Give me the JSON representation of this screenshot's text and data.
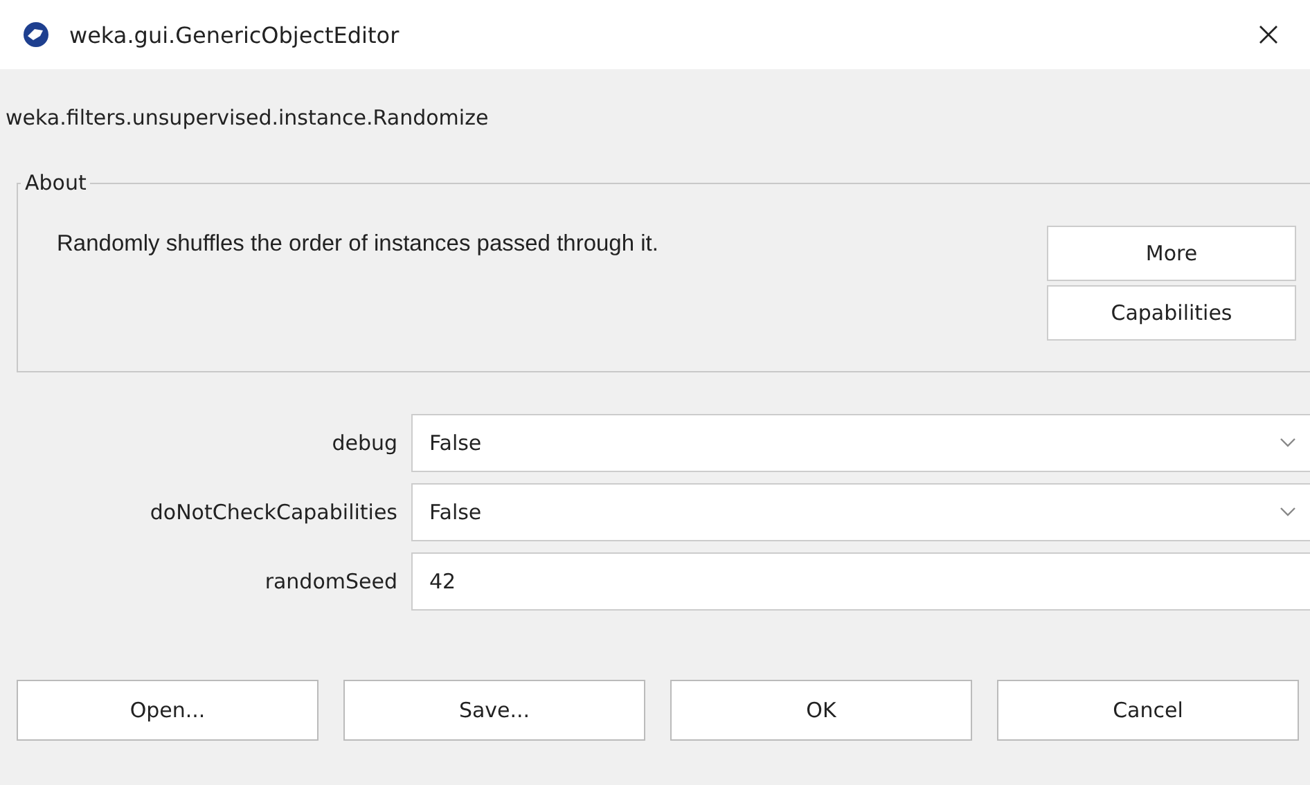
{
  "window": {
    "title": "weka.gui.GenericObjectEditor"
  },
  "class_name": "weka.filters.unsupervised.instance.Randomize",
  "about": {
    "title": "About",
    "text": "Randomly shuffles the order of instances passed through it.",
    "buttons": [
      "More",
      "Capabilities"
    ]
  },
  "properties": [
    {
      "label": "debug",
      "kind": "dropdown",
      "value": "False"
    },
    {
      "label": "doNotCheckCapabilities",
      "kind": "dropdown",
      "value": "False"
    },
    {
      "label": "randomSeed",
      "kind": "text",
      "value": "42"
    }
  ],
  "buttons": [
    "Open...",
    "Save...",
    "OK",
    "Cancel"
  ]
}
